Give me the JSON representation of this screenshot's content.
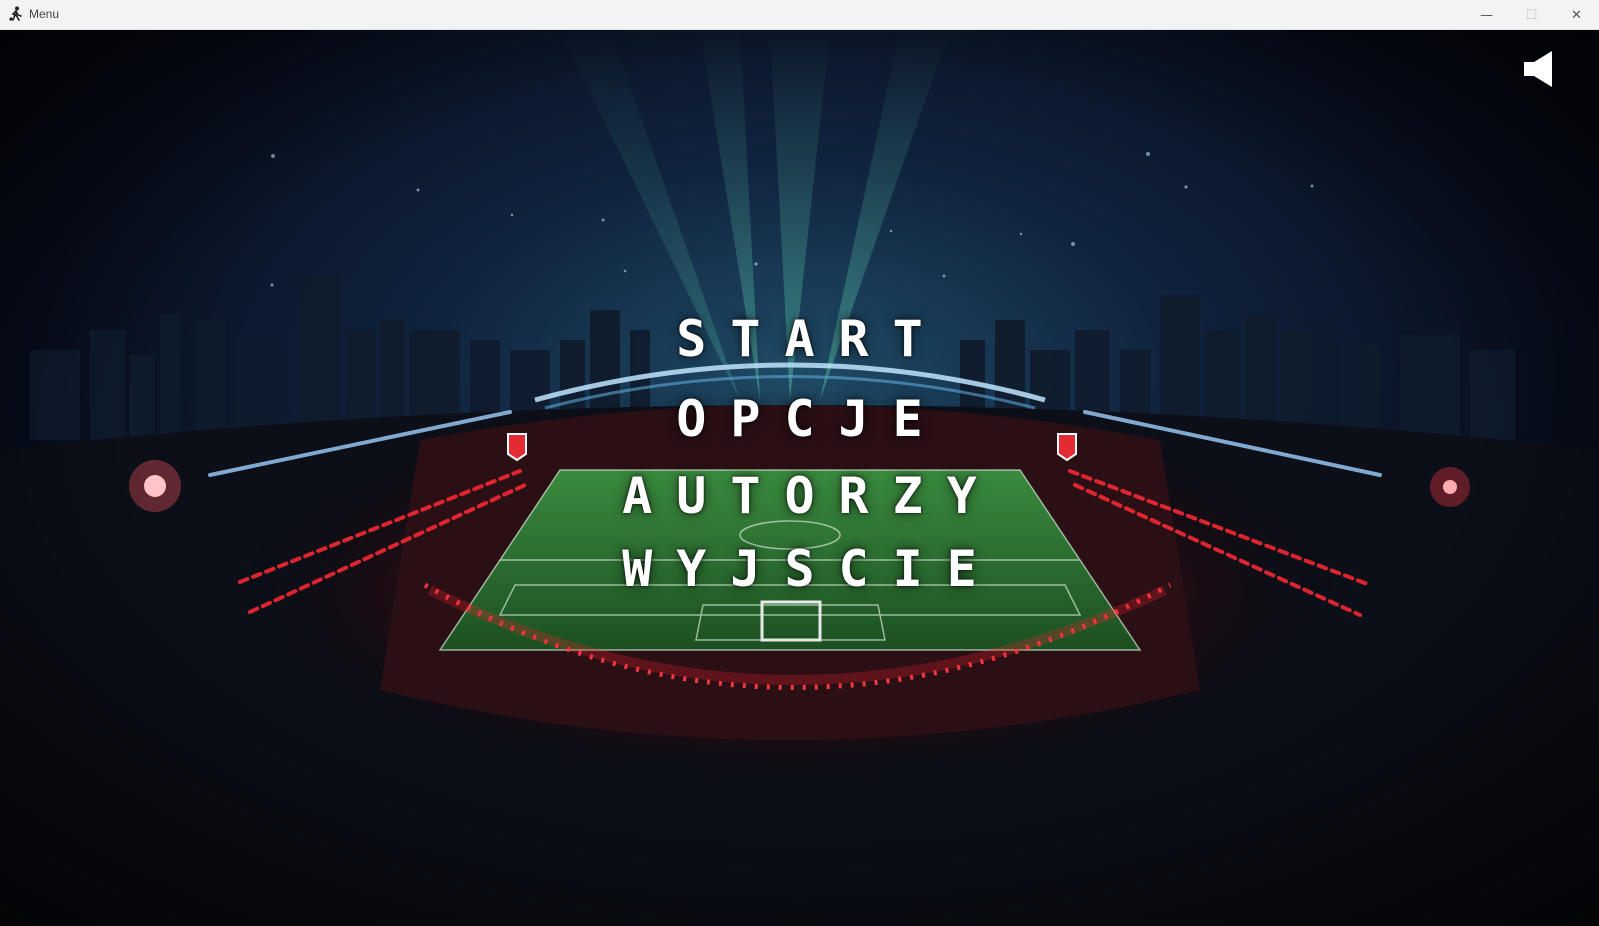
{
  "window": {
    "title": "Menu",
    "controls": {
      "minimize_icon": "minimize-icon",
      "maximize_icon": "maximize-icon",
      "close_icon": "close-icon"
    }
  },
  "menu": {
    "items": [
      {
        "label": "START"
      },
      {
        "label": "OPCJE"
      },
      {
        "label": "AUTORZY"
      },
      {
        "label": "WYJSCIE"
      }
    ]
  },
  "sound": {
    "icon": "speaker-icon",
    "state": "on"
  },
  "colors": {
    "menu_text": "#ffffff",
    "accent_red": "#e0202a",
    "pitch_green": "#2e7a34",
    "sky": "#0b1630"
  }
}
